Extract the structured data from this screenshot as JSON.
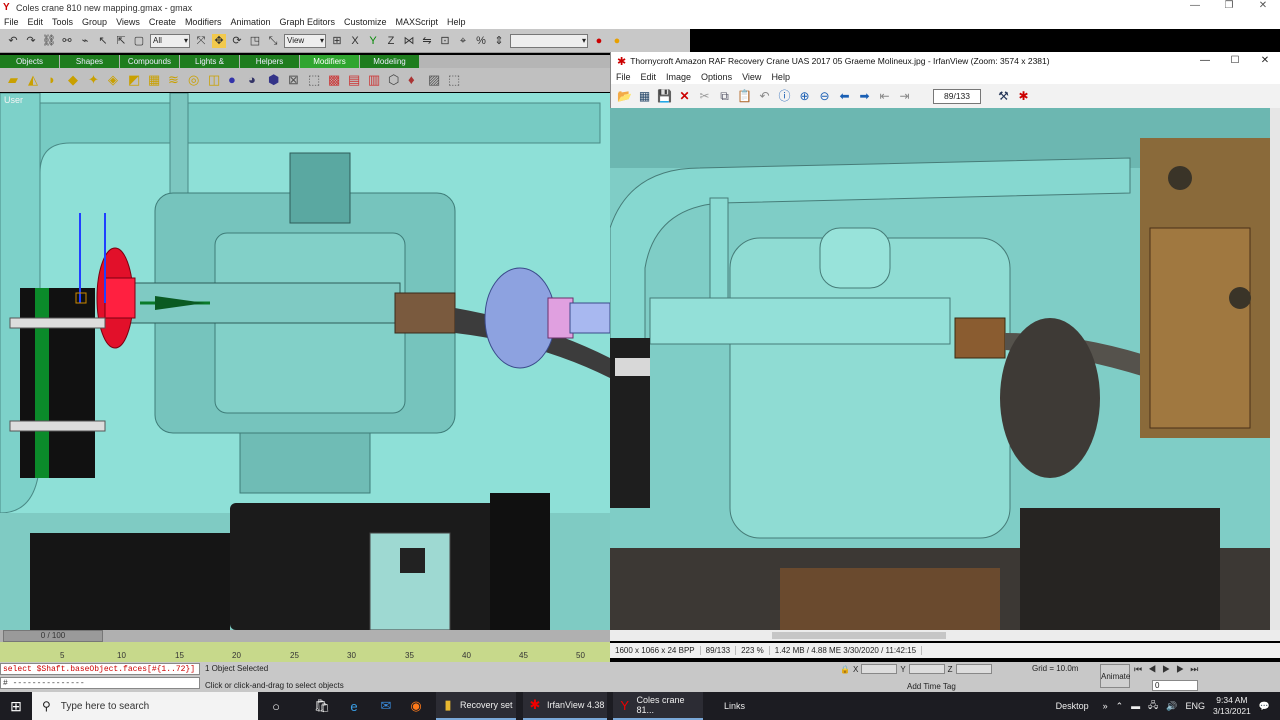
{
  "gmax": {
    "title": "Coles crane 810 new mapping.gmax - gmax",
    "menu": [
      "File",
      "Edit",
      "Tools",
      "Group",
      "Views",
      "Create",
      "Modifiers",
      "Animation",
      "Graph Editors",
      "Customize",
      "MAXScript",
      "Help"
    ],
    "toolbar": {
      "selection_filter": "All",
      "coord_system": "View"
    },
    "tabs": [
      "Objects",
      "Shapes",
      "Compounds",
      "Lights & Cameras",
      "Helpers",
      "Modifiers",
      "Modeling"
    ],
    "active_tab": "Modifiers",
    "viewport_label": "User",
    "slider_label": "0 / 100",
    "timeline_ticks": [
      "5",
      "10",
      "15",
      "20",
      "25",
      "30",
      "35",
      "40",
      "45",
      "50"
    ],
    "listener_line1": "select $Shaft.baseObject.faces[#{1..72}]",
    "listener_line2": "# ---------------",
    "status1": "1 Object Selected",
    "status2": "Click or click-and-drag to select objects",
    "coords": {
      "x_label": "X",
      "y_label": "Y",
      "z_label": "Z"
    },
    "grid": "Grid = 10.0m",
    "add_time_tag": "Add Time Tag",
    "animate": "Animate",
    "frame": "0"
  },
  "irfan": {
    "title": "Thornycroft Amazon RAF Recovery Crane UAS 2017 05 Graeme Molineux.jpg - IrfanView (Zoom: 3574 x 2381)",
    "menu": [
      "File",
      "Edit",
      "Image",
      "Options",
      "View",
      "Help"
    ],
    "counter": "89/133",
    "status": [
      "1600 x 1066 x 24 BPP",
      "89/133",
      "223 %",
      "1.42 MB / 4.88 ME 3/30/2020 / 11:42:15"
    ]
  },
  "taskbar": {
    "search_placeholder": "Type here to search",
    "apps": [
      {
        "label": "Recovery set"
      },
      {
        "label": "IrfanView 4.38"
      },
      {
        "label": "Coles crane 81..."
      }
    ],
    "links": "Links",
    "desktop": "Desktop",
    "lang": "ENG",
    "time": "9:34 AM",
    "date": "3/13/2021"
  }
}
